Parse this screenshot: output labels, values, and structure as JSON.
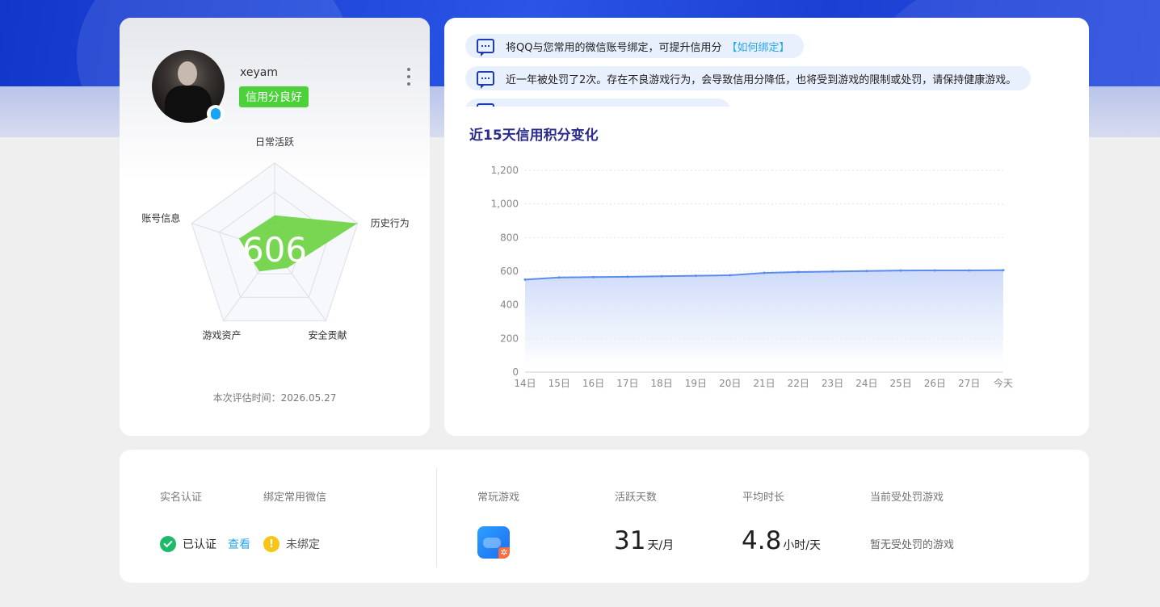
{
  "profile": {
    "username": "xeyam",
    "credit_badge": "信用分良好",
    "score": "606",
    "radar": {
      "labels": [
        "日常活跃",
        "历史行为",
        "安全贡献",
        "游戏资产",
        "账号信息"
      ],
      "values": [
        0.4,
        1.0,
        0.25,
        0.3,
        0.43
      ],
      "fill_color": "#6ad13f"
    },
    "eval_time": "本次评估时间：2026.05.27"
  },
  "notices": [
    {
      "text": "将QQ与您常用的微信账号绑定，可提升信用分",
      "link": "【如何绑定】"
    },
    {
      "text": "近一年被处罚了2次。存在不良游戏行为，会导致信用分降低，也将受到游戏的限制或处罚，请保持健康游戏。",
      "link": ""
    },
    {
      "text": "·······································",
      "link": ""
    }
  ],
  "chart": {
    "title": "近15天信用积分变化"
  },
  "chart_data": {
    "type": "area",
    "title": "近15天信用积分变化",
    "x": [
      "14日",
      "15日",
      "16日",
      "17日",
      "18日",
      "19日",
      "20日",
      "21日",
      "22日",
      "23日",
      "24日",
      "25日",
      "26日",
      "27日",
      "今天"
    ],
    "values": [
      550,
      563,
      565,
      567,
      570,
      573,
      576,
      590,
      595,
      598,
      601,
      604,
      605,
      605,
      606
    ],
    "yticks": [
      "0",
      "200",
      "400",
      "600",
      "800",
      "1,000",
      "1,200"
    ],
    "ylim": [
      0,
      1200
    ],
    "grid": true,
    "line_color": "#5b8def"
  },
  "stats": {
    "real_name_label": "实名认证",
    "wechat_label": "绑定常用微信",
    "verified_text": "已认证",
    "view_link": "查看",
    "unbound_text": "未绑定",
    "warn_glyph": "!",
    "frequent_game_label": "常玩游戏",
    "active_days_label": "活跃天数",
    "avg_time_label": "平均时长",
    "penalty_label": "当前受处罚游戏",
    "active_days_value": "31",
    "active_days_unit": "天/月",
    "avg_time_value": "4.8",
    "avg_time_unit": "小时/天",
    "no_penalty_text": "暂无受处罚的游戏"
  }
}
